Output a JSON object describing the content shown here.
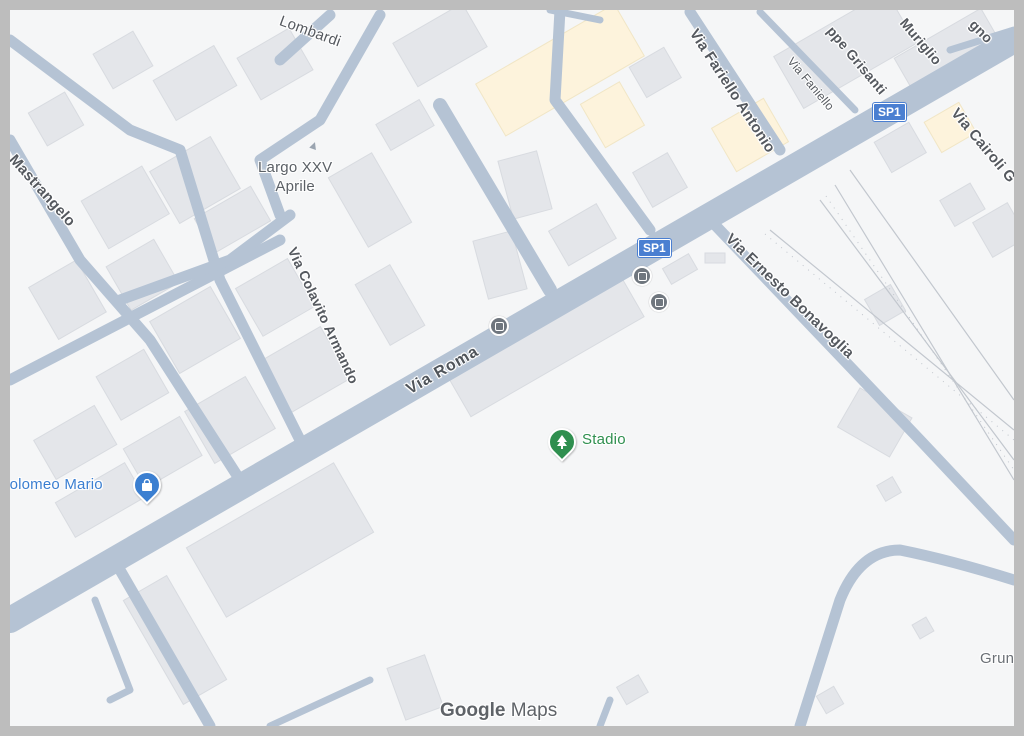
{
  "streets": {
    "lombardi": "Lombardi",
    "farello": "Via Fariello Antonio",
    "fanello": "Via Faniello",
    "grisanti": "ppe Grisanti",
    "muriglio": "Muriglio",
    "gno": "gno",
    "mastrangelo": ". Mastrangelo",
    "colavito": "Via Colavito Armando",
    "via_roma": "Via Roma",
    "bonavoglia": "Via Ernesto Bonavoglia",
    "cairoli": "Via Cairoli G"
  },
  "places": {
    "largo_line1": "Largo XXV",
    "largo_line2": "Aprile",
    "stadio": "Stadio",
    "bartolomeo": "rtolomeo Mario",
    "grun": "Grun"
  },
  "shields": {
    "sp1_a": "SP1",
    "sp1_b": "SP1"
  },
  "logo": {
    "google": "Google",
    "maps": "Maps"
  },
  "colors": {
    "road": "#b5c3d4",
    "park_poi": "#2f8f4f",
    "shop_poi": "#3b7fd1",
    "route_shield": "#4a7fd1"
  },
  "icons": [
    "bus-stop-icon",
    "park-icon",
    "shopping-bag-icon",
    "one-way-arrow-icon"
  ]
}
